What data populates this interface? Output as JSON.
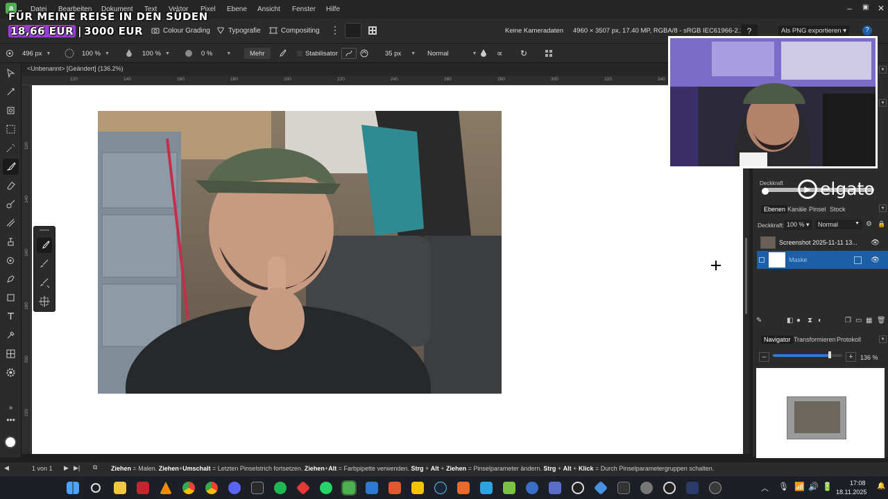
{
  "menu": {
    "items": [
      "Datei",
      "Bearbeiten",
      "Dokument",
      "Text",
      "Vektor",
      "Pixel",
      "Ebene",
      "Ansicht",
      "Fenster",
      "Hilfe"
    ]
  },
  "overlay": {
    "line1": "FÜR MEINE REISE IN DEN SÜDEN",
    "amount": "18,66 EUR",
    "goal": "3000 EUR"
  },
  "persona_bar": {
    "colour_grading": "Colour Grading",
    "typography": "Typografie",
    "compositing": "Compositing",
    "camera_info": "Keine Kameradaten",
    "doc_info": "4960 × 3507 px, 17.40 MP, RGBA/8 - sRGB IEC61966-2.1",
    "export_label": "Als PNG exportieren"
  },
  "context_bar": {
    "width": "496 px",
    "opacity": "100 %",
    "flow": "100 %",
    "hardness": "0 %",
    "more": "Mehr",
    "stabilizer": "Stabilisator",
    "size": "35 px",
    "blend_mode": "Normal"
  },
  "document": {
    "title": "<Unbenannt> [Geändert] (136.2%)",
    "ruler_ticks": [
      "120",
      "140",
      "160",
      "180",
      "200",
      "220",
      "240",
      "260",
      "280",
      "300",
      "320",
      "340"
    ],
    "vruler_ticks": [
      "120",
      "140",
      "160",
      "180",
      "200",
      "220"
    ]
  },
  "panel": {
    "opacity_label": "Deckkraft",
    "brand": "elgato",
    "tabs": [
      "Ebenen",
      "Kanäle",
      "Pinsel",
      "Stock"
    ],
    "layer_opacity_label": "Deckkraft:",
    "layer_opacity": "100 %",
    "layer_blend": "Normal",
    "layers": [
      {
        "name": "Screenshot 2025-11-11 13..."
      },
      {
        "name": "Maske"
      }
    ],
    "nav_tabs": [
      "Navigator",
      "Transformieren",
      "Protokoll"
    ],
    "zoom": "136 %",
    "zoom_fraction": 0.82
  },
  "status": {
    "page": "1 von 1",
    "hint_parts": [
      {
        "b": "Ziehen",
        "t": " = Malen. "
      },
      {
        "b": "Ziehen",
        "t": "+"
      },
      {
        "b": "Umschalt",
        "t": " = Letzten Pinselstrich fortsetzen. "
      },
      {
        "b": "Ziehen",
        "t": "+"
      },
      {
        "b": "Alt",
        "t": " = Farbpipette verwenden. "
      },
      {
        "b": "Strg",
        "t": " + "
      },
      {
        "b": "Alt",
        "t": " + "
      },
      {
        "b": "Ziehen",
        "t": " = Pinselparameter ändern. "
      },
      {
        "b": "Strg",
        "t": " + "
      },
      {
        "b": "Alt",
        "t": " + "
      },
      {
        "b": "Klick",
        "t": " = Durch Pinselparametergruppen schalten."
      }
    ]
  },
  "taskbar": {
    "time": "17:08",
    "date": "18.11.2025"
  },
  "colors": {
    "accent": "#1c5fa6",
    "bg": "#2b2b2b",
    "highlight_purple": "#9b3fd6"
  }
}
